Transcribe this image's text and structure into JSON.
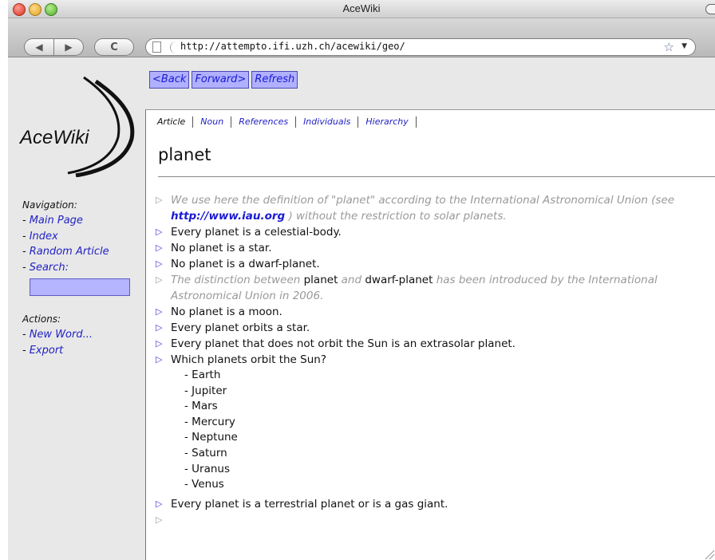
{
  "window": {
    "title": "AceWiki"
  },
  "browser": {
    "url": "http://attempto.ifi.uzh.ch/acewiki/geo/"
  },
  "logo": {
    "text": "AceWiki"
  },
  "sidebar": {
    "nav_heading": "Navigation:",
    "nav_items": [
      "Main Page",
      "Index",
      "Random Article",
      "Search:"
    ],
    "actions_heading": "Actions:",
    "action_items": [
      "New Word...",
      "Export"
    ]
  },
  "history": {
    "back": "<Back",
    "forward": "Forward>",
    "refresh": "Refresh"
  },
  "tabs": [
    "Article",
    "Noun",
    "References",
    "Individuals",
    "Hierarchy"
  ],
  "article": {
    "title": "planet",
    "comment1_a": "We use here the definition of \"planet\" according to the International Astronomical Union (see ",
    "comment1_link": "http://www.iau.org",
    "comment1_b": " ) without the restriction to solar planets.",
    "s1": "Every planet is a celestial-body.",
    "s2": "No planet is a star.",
    "s3": "No planet is a dwarf-planet.",
    "comment2_a": "The distinction between ",
    "comment2_kw1": "planet",
    "comment2_b": " and ",
    "comment2_kw2": "dwarf-planet",
    "comment2_c": " has been introduced by the International Astronomical Union in 2006.",
    "s4": "No planet is a moon.",
    "s5": "Every planet orbits a star.",
    "s6": "Every planet that does not orbit the Sun is an extrasolar planet.",
    "q1": "Which planets orbit the Sun?",
    "answers": [
      "Earth",
      "Jupiter",
      "Mars",
      "Mercury",
      "Neptune",
      "Saturn",
      "Uranus",
      "Venus"
    ],
    "s7": "Every planet is a terrestrial planet or is a gas giant."
  },
  "icons": {
    "triangle": "▷",
    "star": "☆",
    "back": "◀",
    "forward": "▶",
    "reload": "C"
  },
  "colors": {
    "link": "#2222c4",
    "comment": "#999999",
    "button_bg": "#b0b0ff"
  }
}
